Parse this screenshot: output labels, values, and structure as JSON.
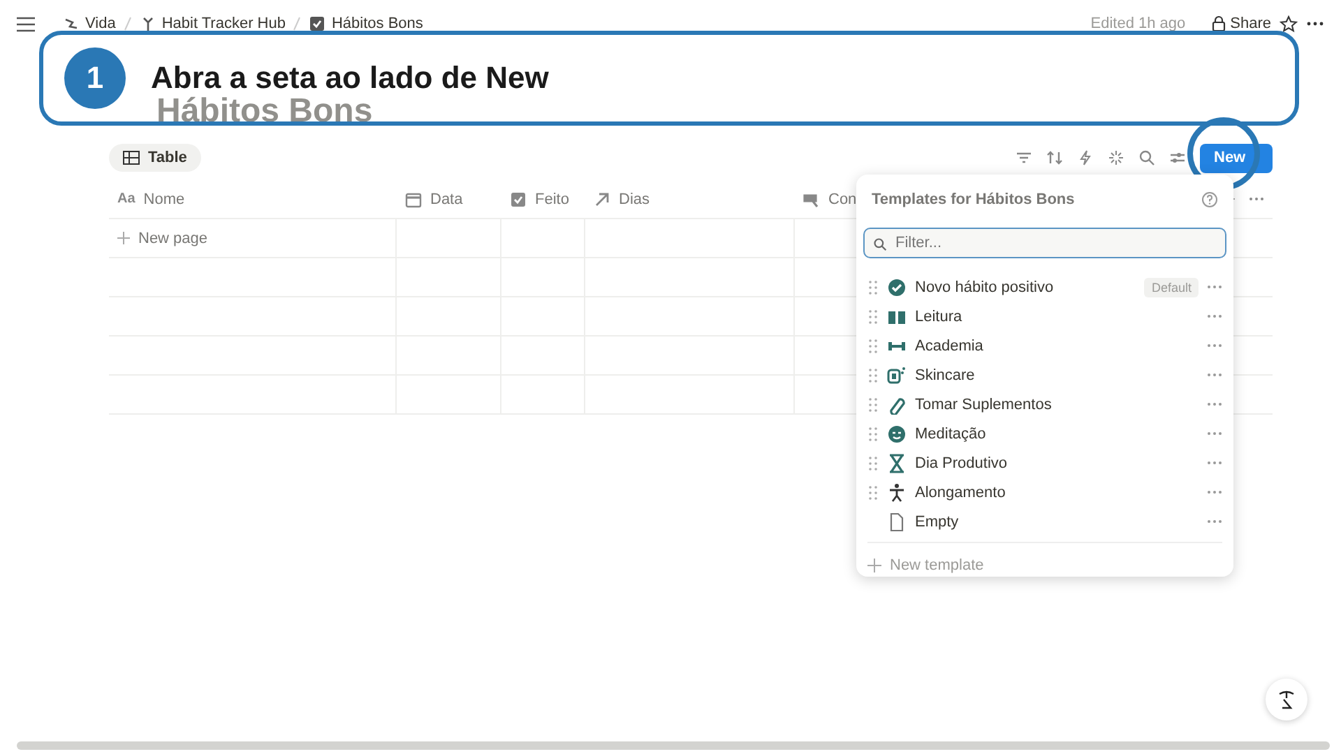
{
  "breadcrumbs": [
    {
      "label": "Vida"
    },
    {
      "label": "Habit Tracker Hub"
    },
    {
      "label": "Hábitos Bons"
    }
  ],
  "top_bar": {
    "edited": "Edited 1h ago",
    "share": "Share"
  },
  "page_title": "Hábitos Bons",
  "view_tab": {
    "label": "Table",
    "selected": true
  },
  "new_button": {
    "label": "New"
  },
  "table": {
    "columns": [
      {
        "label": "Nome",
        "icon_text": "Aa"
      },
      {
        "label": "Data"
      },
      {
        "label": "Feito"
      },
      {
        "label": "Dias"
      },
      {
        "label": "Con"
      }
    ],
    "new_row": "New page"
  },
  "templates_menu": {
    "title": "Templates for Hábitos Bons",
    "filter_placeholder": "Filter...",
    "items": [
      {
        "label": "Novo hábito positivo",
        "badge": "Default",
        "draggable": true
      },
      {
        "label": "Leitura",
        "draggable": true
      },
      {
        "label": "Academia",
        "draggable": true
      },
      {
        "label": "Skincare",
        "draggable": true
      },
      {
        "label": "Tomar Suplementos",
        "draggable": true
      },
      {
        "label": "Meditação",
        "draggable": true
      },
      {
        "label": "Dia Produtivo",
        "draggable": true
      },
      {
        "label": "Alongamento",
        "draggable": true
      },
      {
        "label": "Empty",
        "draggable": false
      }
    ],
    "new_template": "New template"
  },
  "callout": {
    "step": "1",
    "text": "Abra a seta ao lado de New"
  }
}
